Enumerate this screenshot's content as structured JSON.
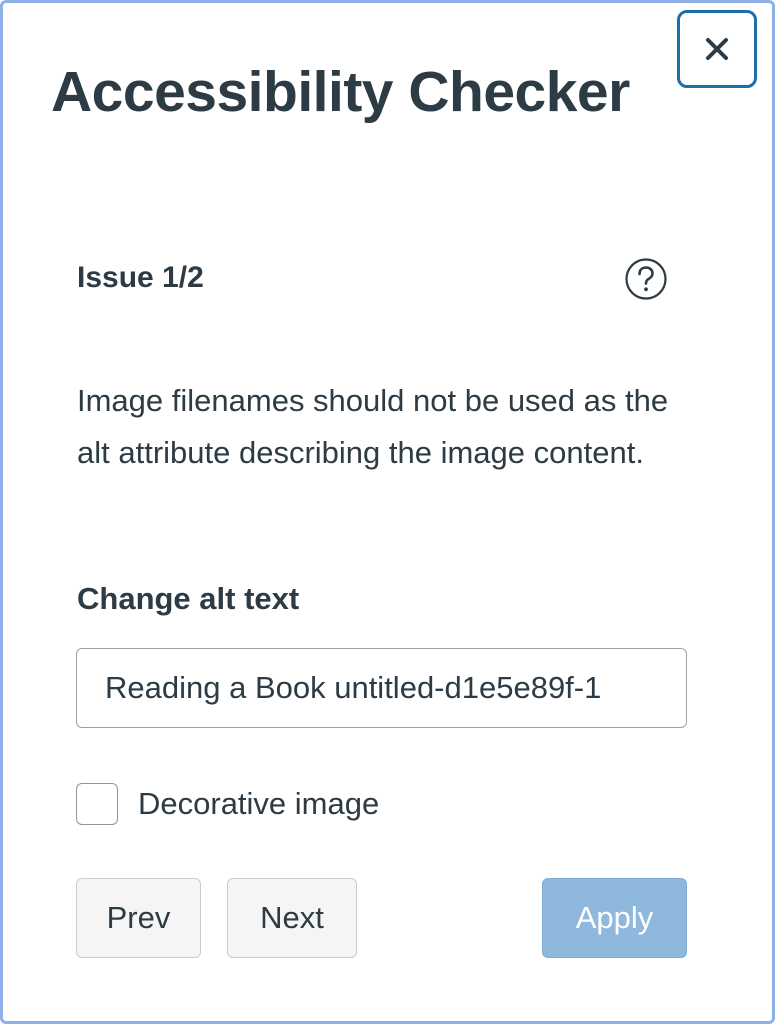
{
  "panel": {
    "title": "Accessibility Checker",
    "close_label": "×"
  },
  "issue": {
    "counter": "Issue 1/2",
    "help_icon": "question-circle-icon",
    "message": "Image filenames should not be used as the alt attribute describing the image content."
  },
  "form": {
    "field_label": "Change alt text",
    "alt_value": "Reading a Book untitled-d1e5e89f-1",
    "checkbox_label": "Decorative image",
    "checkbox_checked": false
  },
  "actions": {
    "prev_label": "Prev",
    "next_label": "Next",
    "apply_label": "Apply"
  },
  "colors": {
    "text": "#2d3b45",
    "close_border": "#1f6ea8",
    "apply_bg": "#8fb9dc",
    "panel_border": "#8fb0e8"
  }
}
